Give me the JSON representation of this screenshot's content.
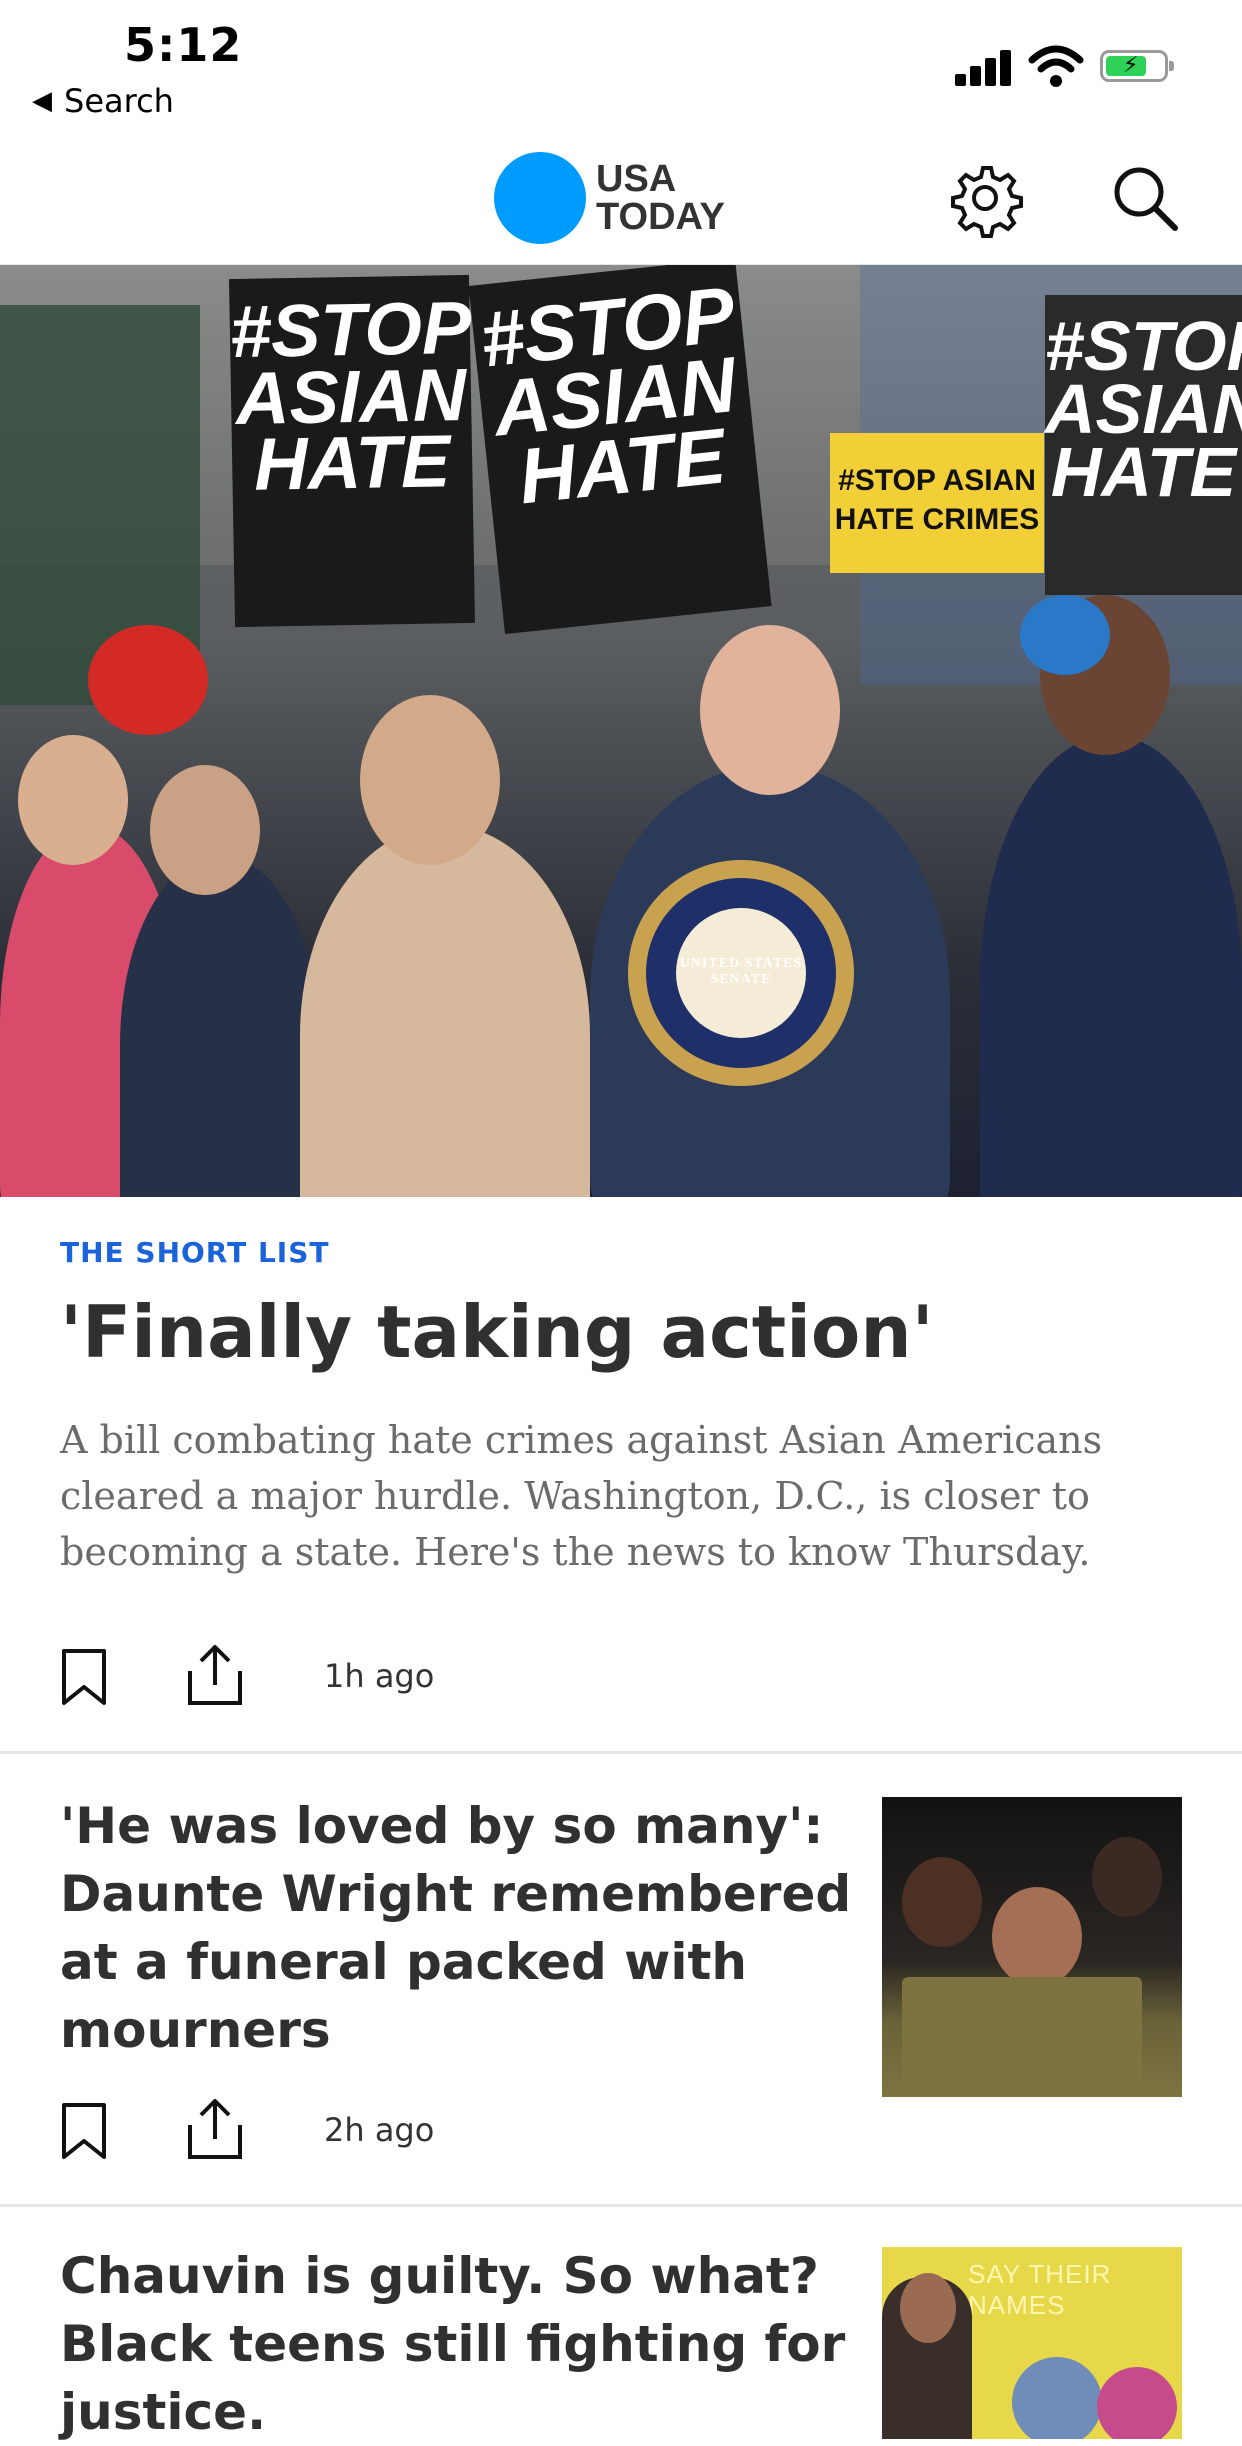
{
  "status_bar": {
    "time": "5:12",
    "back_label": "Search"
  },
  "header": {
    "logo_line1": "USA",
    "logo_line2": "TODAY",
    "brand_color": "#009bff"
  },
  "hero": {
    "sign_text_1": "#STOP ASIAN HATE",
    "sign_text_2": "#STOP ASIAN HATE",
    "sign_text_3": "#STOP ASIAN HATE CRIMES",
    "sign_text_4": "#STOP ASIAN HATE",
    "seal_text": "UNITED STATES SENATE"
  },
  "lead": {
    "kicker": "THE SHORT LIST",
    "title": "'Finally taking action'",
    "summary": "A bill combating hate crimes against Asian Americans cleared a major hurdle. Washington, D.C., is closer to becoming a state. Here's the news to know Thursday.",
    "time": "1h ago"
  },
  "stories": [
    {
      "title": "'He was loved by so many': Daunte Wright remembered at a funeral packed with mourners",
      "time": "2h ago"
    },
    {
      "title": "Chauvin is guilty. So what? Black teens still fighting for justice.",
      "thumb_text": "SAY THEIR NAMES"
    }
  ],
  "icons": [
    "back-triangle-icon",
    "signal-icon",
    "wifi-icon",
    "battery-icon",
    "gear-icon",
    "search-icon",
    "bookmark-icon",
    "share-icon"
  ],
  "colors": {
    "kicker": "#1a63d9",
    "title": "#303030",
    "summary": "#6b6b6b"
  }
}
